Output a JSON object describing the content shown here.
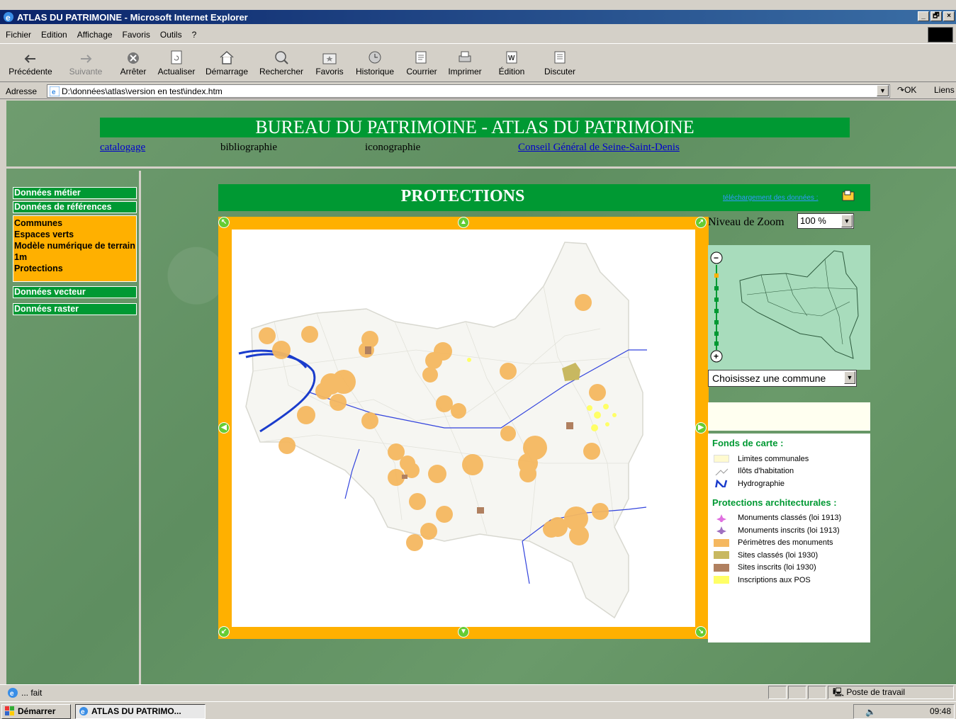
{
  "window": {
    "title": "ATLAS DU PATRIMOINE - Microsoft Internet Explorer",
    "btn_min": "_",
    "btn_max": "🗗",
    "btn_close": "×"
  },
  "menu": [
    "Fichier",
    "Edition",
    "Affichage",
    "Favoris",
    "Outils",
    "?"
  ],
  "toolbar": [
    {
      "label": "Précédente",
      "icon": "back-arrow-icon"
    },
    {
      "label": "Suivante",
      "icon": "forward-arrow-icon"
    },
    {
      "label": "Arrêter",
      "icon": "stop-icon"
    },
    {
      "label": "Actualiser",
      "icon": "refresh-icon"
    },
    {
      "label": "Démarrage",
      "icon": "home-icon"
    },
    {
      "label": "Rechercher",
      "icon": "search-icon"
    },
    {
      "label": "Favoris",
      "icon": "favorites-icon"
    },
    {
      "label": "Historique",
      "icon": "history-icon"
    },
    {
      "label": "Courrier",
      "icon": "mail-icon"
    },
    {
      "label": "Imprimer",
      "icon": "print-icon"
    },
    {
      "label": "Édition",
      "icon": "edit-icon"
    },
    {
      "label": "Discuter",
      "icon": "discuss-icon"
    }
  ],
  "address": {
    "label": "Adresse",
    "value": "D:\\données\\atlas\\version en test\\index.htm",
    "go": "OK",
    "links": "Liens"
  },
  "header": {
    "title": "BUREAU DU PATRIMOINE - ATLAS DU PATRIMOINE",
    "links": {
      "catalogage": "catalogage",
      "bibliographie": "bibliographie",
      "iconographie": "iconographie",
      "conseil": "Conseil Général de Seine-Saint-Denis"
    }
  },
  "leftnav": {
    "donnees_metier": "Données métier",
    "donnees_references": "Données de références",
    "sub": [
      "Communes",
      "Espaces verts",
      "Modèle numérique de terrain 1m",
      "Protections"
    ],
    "donnees_vecteur": "Données vecteur",
    "donnees_raster": "Données raster"
  },
  "main": {
    "title": "PROTECTIONS",
    "download": "téléchargement des données :",
    "zoom_label": "Niveau de Zoom",
    "zoom_value": "100 %",
    "commune_select": "Choisissez une commune"
  },
  "legend": {
    "fonds_title": "Fonds de carte :",
    "fonds": [
      "Limites communales",
      "Ilôts d'habitation",
      "Hydrographie"
    ],
    "prot_title": "Protections architecturales :",
    "prot": [
      "Monuments classés (loi 1913)",
      "Monuments inscrits (loi 1913)",
      "Périmètres des monuments",
      "Sites classés (loi 1930)",
      "Sites inscrits (loi 1930)",
      "Inscriptions aux POS"
    ]
  },
  "colors": {
    "green": "#009933",
    "orange": "#ffb000",
    "circle": "#f5b860",
    "site_classe": "#c8b860",
    "site_inscrit": "#b08060",
    "pos": "#ffff66",
    "hydro": "#1a3ccc"
  },
  "status": {
    "text": "... fait",
    "zone": "Poste de travail"
  },
  "taskbar": {
    "start": "Démarrer",
    "item": "ATLAS DU PATRIMO...",
    "time": "09:48"
  }
}
